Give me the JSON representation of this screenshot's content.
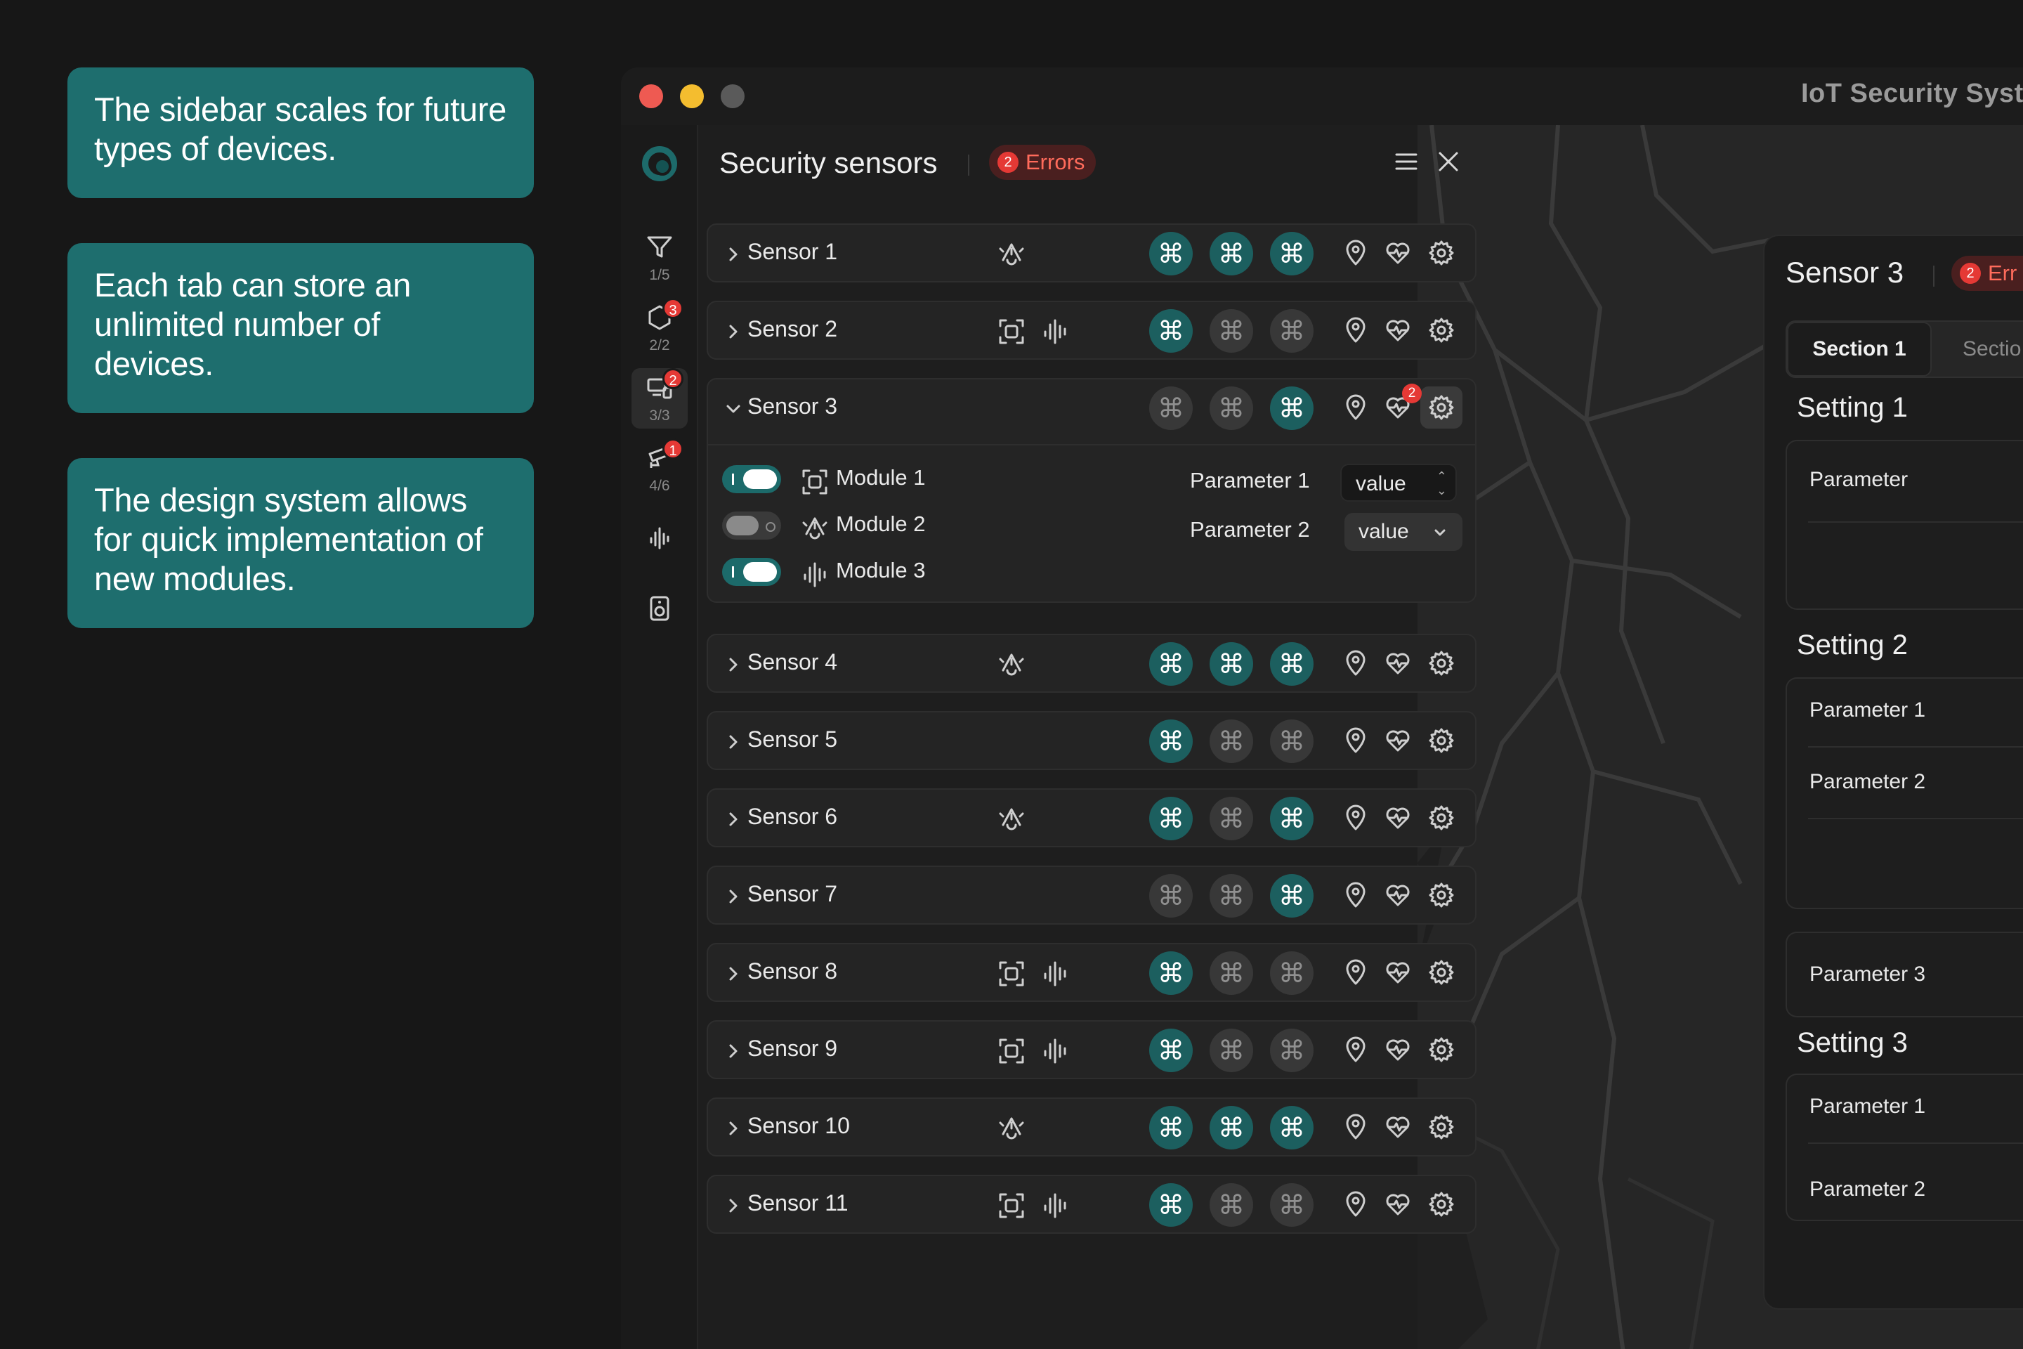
{
  "callouts": [
    "The sidebar scales for future types of devices.",
    "Each tab can store an unlimited number of devices.",
    "The design system allows for quick implementation of new modules."
  ],
  "window": {
    "title": "IoT Security Syst",
    "traffic_lights": {
      "close": "#ee5a52",
      "minimize": "#f4bd2f",
      "zoom": "#5a5a5a"
    }
  },
  "rail": {
    "items": [
      {
        "icon": "filter-icon",
        "count": "1/5",
        "badge": ""
      },
      {
        "icon": "hexagon-icon",
        "count": "2/2",
        "badge": "3"
      },
      {
        "icon": "sensor-device-icon",
        "count": "3/3",
        "badge": "2"
      },
      {
        "icon": "camera-icon",
        "count": "4/6",
        "badge": "1"
      },
      {
        "icon": "waveform-icon",
        "count": "",
        "badge": ""
      },
      {
        "icon": "speaker-icon",
        "count": "",
        "badge": ""
      }
    ]
  },
  "panel": {
    "title": "Security sensors",
    "errors_count": "2",
    "errors_label": "Errors"
  },
  "sensors": [
    {
      "name": "Sensor 1",
      "modules": [
        "alarm"
      ],
      "cmd": [
        true,
        true,
        true
      ]
    },
    {
      "name": "Sensor 2",
      "modules": [
        "scan",
        "wave"
      ],
      "cmd": [
        true,
        false,
        false
      ]
    },
    {
      "name": "Sensor 3",
      "modules": [],
      "cmd": [
        false,
        false,
        true
      ],
      "expanded": true,
      "health_badge": "2"
    },
    {
      "name": "Sensor 4",
      "modules": [
        "alarm"
      ],
      "cmd": [
        true,
        true,
        true
      ]
    },
    {
      "name": "Sensor 5",
      "modules": [],
      "cmd": [
        true,
        false,
        false
      ]
    },
    {
      "name": "Sensor 6",
      "modules": [
        "alarm"
      ],
      "cmd": [
        true,
        false,
        true
      ]
    },
    {
      "name": "Sensor 7",
      "modules": [],
      "cmd": [
        false,
        false,
        true
      ]
    },
    {
      "name": "Sensor 8",
      "modules": [
        "scan",
        "wave"
      ],
      "cmd": [
        true,
        false,
        false
      ]
    },
    {
      "name": "Sensor 9",
      "modules": [
        "scan",
        "wave"
      ],
      "cmd": [
        true,
        false,
        false
      ]
    },
    {
      "name": "Sensor 10",
      "modules": [
        "alarm"
      ],
      "cmd": [
        true,
        true,
        true
      ]
    },
    {
      "name": "Sensor 11",
      "modules": [
        "scan",
        "wave"
      ],
      "cmd": [
        true,
        false,
        false
      ]
    }
  ],
  "expanded_sensor": {
    "modules": [
      {
        "label": "Module 1",
        "enabled": true,
        "icon": "scan-icon"
      },
      {
        "label": "Module 2",
        "enabled": false,
        "icon": "alarm-icon"
      },
      {
        "label": "Module 3",
        "enabled": true,
        "icon": "waveform-icon"
      }
    ],
    "param1_label": "Parameter 1",
    "param1_value": "value",
    "param2_label": "Parameter 2",
    "param2_value": "value"
  },
  "detail": {
    "title": "Sensor 3",
    "errors_count": "2",
    "errors_label": "Err",
    "tab_active": "Section 1",
    "tab_other": "Sectio",
    "setting1": "Setting 1",
    "setting1_param": "Parameter",
    "setting2": "Setting 2",
    "setting2_param1": "Parameter 1",
    "setting2_param2": "Parameter 2",
    "setting2_param3": "Parameter 3",
    "setting3": "Setting 3",
    "setting3_param1": "Parameter 1",
    "setting3_param2": "Parameter 2"
  },
  "colors": {
    "accent": "#1c5f5f",
    "callout": "#1e6e6e",
    "error": "#e53935"
  }
}
